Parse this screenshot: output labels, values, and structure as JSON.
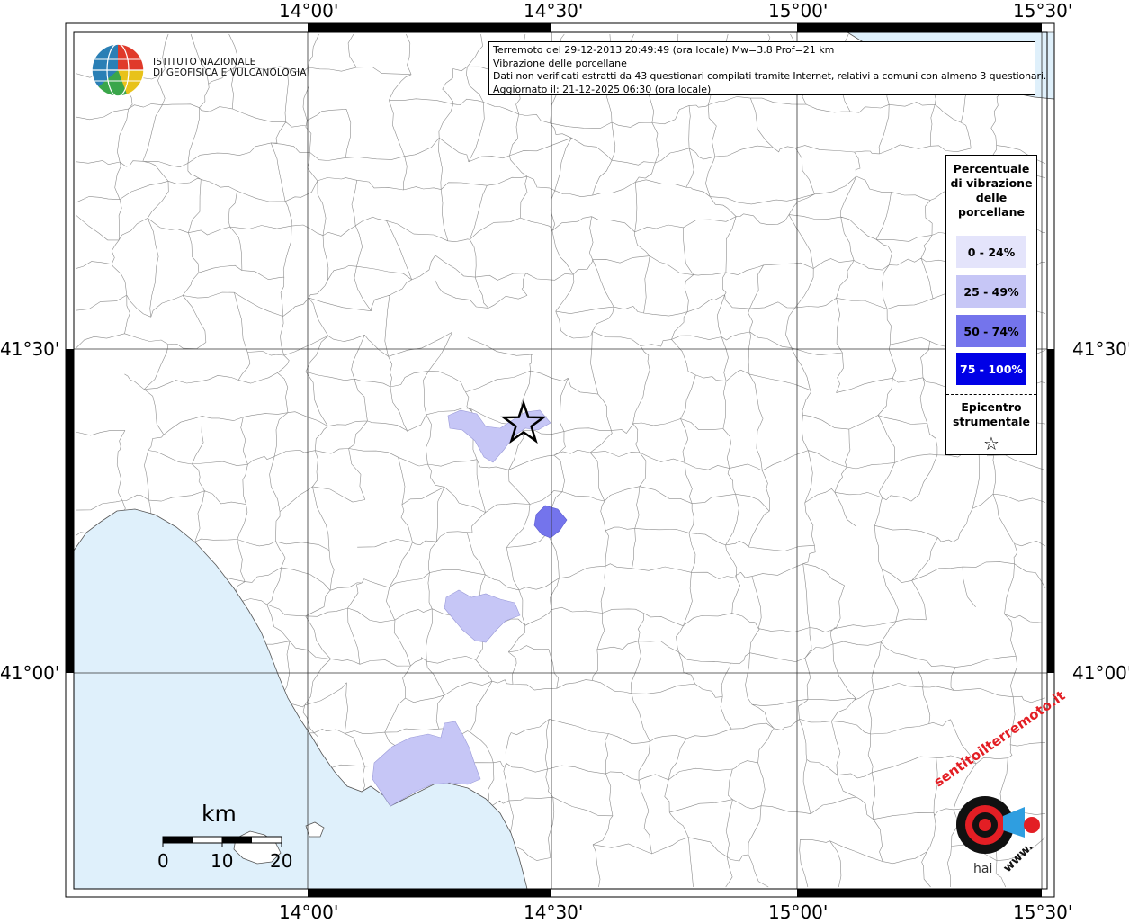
{
  "map": {
    "title_lines": [
      "Terremoto del 29-12-2013 20:49:49 (ora locale) Mw=3.8 Prof=21 km",
      "Vibrazione delle porcellane",
      "Dati non verificati estratti da 43 questionari compilati tramite Internet, relativi a comuni con almeno 3 questionari.",
      "Aggiornato il: 21-12-2025 06:30 (ora locale)"
    ],
    "longitude_labels": [
      "14°00'",
      "14°30'",
      "15°00'",
      "15°30'"
    ],
    "latitude_labels": [
      "41°30'",
      "41°00'"
    ],
    "sea_color": "#dff0fb",
    "land_color": "#ffffff",
    "boundary_color": "#8c8c8c"
  },
  "institute": {
    "line1": "ISTITUTO NAZIONALE",
    "line2": "DI GEOFISICA E VULCANOLOGIA"
  },
  "legend": {
    "title_lines": [
      "Percentuale",
      "di vibrazione",
      "delle",
      "porcellane"
    ],
    "items": [
      {
        "label": "0 - 24%",
        "color": "#e4e4fb",
        "text_color": "#000000"
      },
      {
        "label": "25 - 49%",
        "color": "#c6c6f6",
        "text_color": "#000000"
      },
      {
        "label": "50 - 74%",
        "color": "#7474ec",
        "text_color": "#000000"
      },
      {
        "label": "75 - 100%",
        "color": "#0000e6",
        "text_color": "#ffffff"
      }
    ],
    "epicenter_lines": [
      "Epicentro",
      "strumentale"
    ]
  },
  "scale": {
    "unit": "km",
    "ticks": [
      "0",
      "10",
      "20"
    ]
  },
  "brand": {
    "text_top": "sentitoilterremoto.it",
    "text_prefix": "hai",
    "text_bottom": "www."
  }
}
